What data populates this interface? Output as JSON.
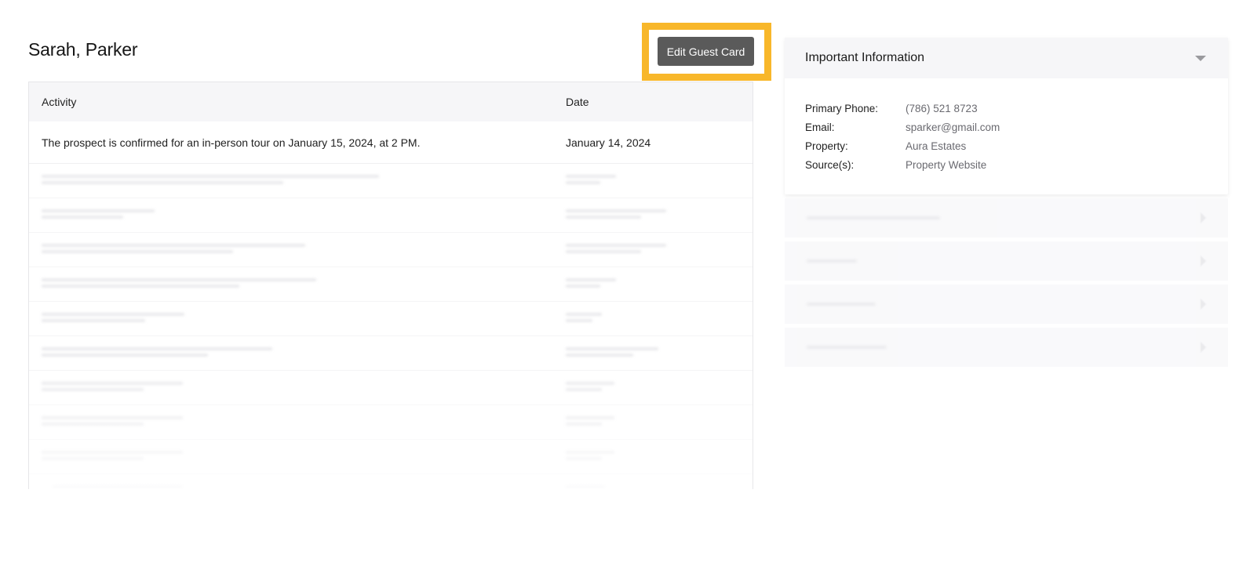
{
  "header": {
    "guest_name": "Sarah, Parker",
    "edit_button_label": "Edit Guest Card"
  },
  "activity_table": {
    "columns": [
      "Activity",
      "Date"
    ],
    "rows": [
      {
        "activity": "The prospect is confirmed for an in-person tour on January 15, 2024, at 2 PM.",
        "date": "January 14, 2024"
      }
    ]
  },
  "important_info": {
    "title": "Important Information",
    "fields": [
      {
        "label": "Primary Phone:",
        "value": "(786) 521 8723"
      },
      {
        "label": "Email:",
        "value": "sparker@gmail.com"
      },
      {
        "label": "Property:",
        "value": "Aura Estates"
      },
      {
        "label": "Source(s):",
        "value": "Property Website"
      }
    ]
  },
  "colors": {
    "highlight": "#f8b72a",
    "button_bg": "#5a5a5a",
    "header_bg": "#f6f6f8"
  },
  "icons": {
    "expand": "caret-down-icon",
    "collapsed": "caret-right-icon"
  }
}
